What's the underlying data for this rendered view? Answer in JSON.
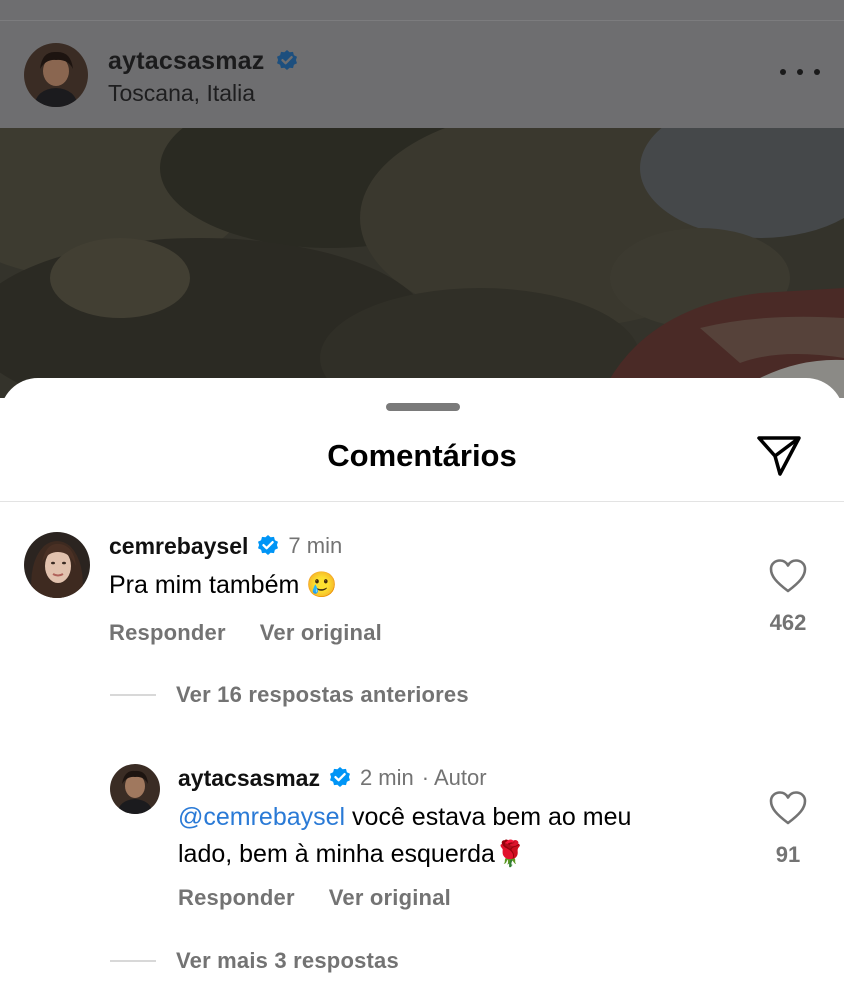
{
  "post": {
    "username": "aytacsasmaz",
    "location": "Toscana, Italia",
    "verified_icon": "verified-badge-icon",
    "more_icon": "more-options-icon"
  },
  "sheet": {
    "title": "Comentários",
    "share_icon": "send-icon"
  },
  "comments": [
    {
      "username": "cemrebaysel",
      "time": "7 min",
      "text": "Pra mim também",
      "emoji": "🥲",
      "reply_label": "Responder",
      "translate_label": "Ver original",
      "likes": "462",
      "previous_replies_label": "Ver 16 respostas anteriores"
    }
  ],
  "replies": [
    {
      "username": "aytacsasmaz",
      "time": "2 min",
      "author_tag": "· Autor",
      "mention": "@cemrebaysel",
      "text_line1": " você estava bem ao meu",
      "text_line2": "lado, bem à minha esquerda",
      "emoji": "🌹",
      "reply_label": "Responder",
      "translate_label": "Ver original",
      "likes": "91",
      "more_replies_label": "Ver mais 3 respostas"
    }
  ],
  "colors": {
    "accent_blue": "#2a7ad6",
    "verified_blue": "#0095f6",
    "muted_gray": "#737373"
  }
}
